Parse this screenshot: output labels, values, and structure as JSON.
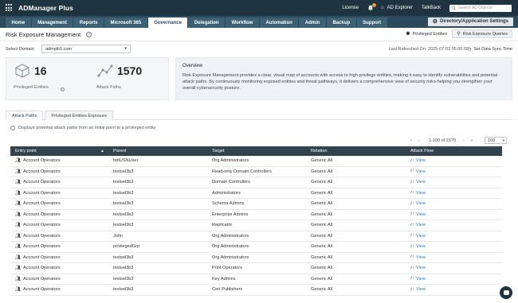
{
  "app": {
    "title": "ADManager Plus",
    "top_links": {
      "license": "License",
      "ad_explorer": "AD Explorer",
      "talkback": "TalkBack"
    },
    "search_placeholder": "Search AD Objects"
  },
  "nav": {
    "tabs": [
      "Home",
      "Management",
      "Reports",
      "Microsoft 365",
      "Governance",
      "Delegation",
      "Workflow",
      "Automation",
      "Admin",
      "Backup",
      "Support"
    ],
    "active_tab": "Governance",
    "settings_label": "Directory/Application Settings"
  },
  "page": {
    "title": "Risk Exposure Management",
    "privileged_entities_label": "Privileged Entities",
    "risk_queries_label": "Risk Exposure Queries",
    "select_domain_label": "Select Domain",
    "domain_value": "admplb1.com",
    "last_refreshed": "Last Refreshed On:  2025-07-03 05:00:00",
    "sync_label": "Set Data Sync Time"
  },
  "stats": {
    "privileged_entities": {
      "value": "16",
      "label": "Privileged Entities"
    },
    "attack_paths": {
      "value": "1570",
      "label": "Attack Paths"
    }
  },
  "overview": {
    "title": "Overview",
    "text": "Risk Exposure Management provides a clear, visual map of accounts with access to high-privilege entities, making it easy to identify vulnerabilities and potential attack paths. By continuously monitoring exposed entities and threat pathways, it delivers a comprehensive view of security risks-helping you strengthen your overall cybersecurity posture."
  },
  "content_tabs": [
    "Attack Paths",
    "Privileged Entities Exposure"
  ],
  "info_text": "Displays potential attack paths from an initial point to a privileged entity",
  "pager": {
    "range": "1-100 of 1570",
    "page_size": "100"
  },
  "table": {
    "columns": [
      "Entry point",
      "Parent",
      "Target",
      "Relation",
      "Attack Flow"
    ],
    "rows": [
      [
        "Account Operators",
        "hdtUSNUser",
        "Org Administrators",
        "Generic All",
        "View"
      ],
      [
        "Account Operators",
        "testsel3b3",
        "Read-only Domain Controllers",
        "Generic All",
        "View"
      ],
      [
        "Account Operators",
        "testsel3b3",
        "Domain Controllers",
        "Generic All",
        "View"
      ],
      [
        "Account Operators",
        "testsel3b3",
        "Administrators",
        "Generic All",
        "View"
      ],
      [
        "Account Operators",
        "testsel3b3",
        "Schema Admins",
        "Generic All",
        "View"
      ],
      [
        "Account Operators",
        "testsel3b3",
        "Enterprise Admins",
        "Generic All",
        "View"
      ],
      [
        "Account Operators",
        "testsel3b3",
        "Replicator",
        "Generic All",
        "View"
      ],
      [
        "Account Operators",
        "John",
        "Org Administrators",
        "Generic All",
        "View"
      ],
      [
        "Account Operators",
        "privilegedGrp",
        "Org Administrators",
        "Generic All",
        "View"
      ],
      [
        "Account Operators",
        "testsel3b3",
        "Org Administrators",
        "Generic All",
        "View"
      ],
      [
        "Account Operators",
        "testsel3b3",
        "Print Operators",
        "Generic All",
        "View"
      ],
      [
        "Account Operators",
        "testsel3b3",
        "Key Admins",
        "Generic All",
        "View"
      ],
      [
        "Account Operators",
        "testsel3b3",
        "Cert Publishers",
        "Generic All",
        "View"
      ]
    ]
  }
}
